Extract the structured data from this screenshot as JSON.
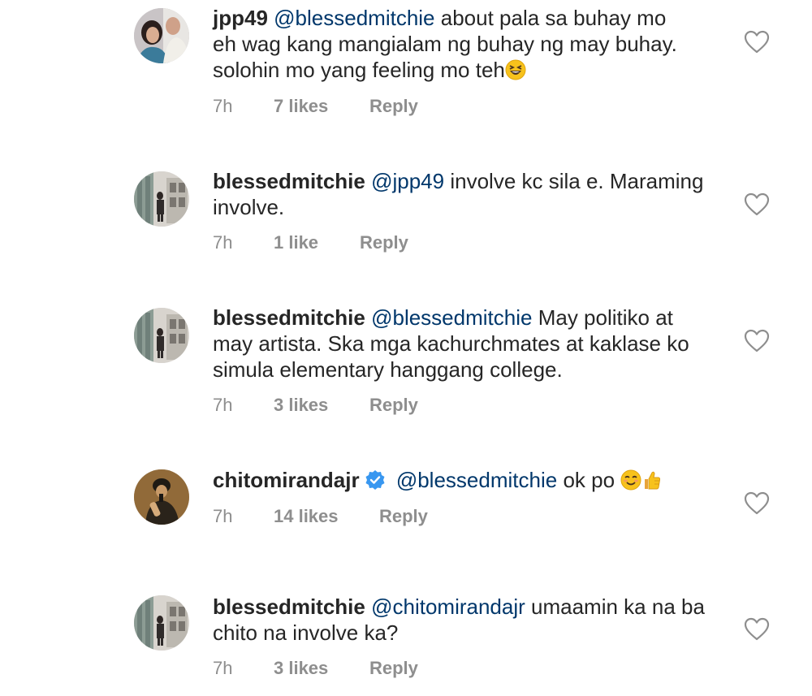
{
  "comments": [
    {
      "username": "jpp49",
      "lines": [
        "about pala sa buhay mo",
        "eh wag kang mangialam ng buhay ng may buhay.",
        "solohin mo yang feeling mo teh"
      ],
      "mention": "@blessedmitchie",
      "emoji": "grinning-squinting-face",
      "time": "7h",
      "likes": "7 likes",
      "reply": "Reply"
    },
    {
      "username": "blessedmitchie",
      "mention": "@jpp49",
      "line1": "involve kc sila e. Maraming",
      "line2": "involve.",
      "time": "7h",
      "likes": "1 like",
      "reply": "Reply"
    },
    {
      "username": "blessedmitchie",
      "mention": "@blessedmitchie",
      "line1": "May politiko at",
      "line2": "may artista. Ska mga kachurchmates at kaklase ko",
      "line3": "simula elementary hanggang college.",
      "time": "7h",
      "likes": "3 likes",
      "reply": "Reply"
    },
    {
      "username": "chitomirandajr",
      "verified": true,
      "mention": "@blessedmitchie",
      "text": "ok po",
      "emojis": [
        "smiling-face",
        "thumbs-up"
      ],
      "time": "7h",
      "likes": "14 likes",
      "reply": "Reply"
    },
    {
      "username": "blessedmitchie",
      "mention": "@chitomirandajr",
      "line1": "umaamin ka na ba",
      "line2": "chito na involve ka?",
      "time": "7h",
      "likes": "3 likes",
      "reply": "Reply"
    }
  ],
  "colors": {
    "text": "#262626",
    "mention": "#00376b",
    "meta": "#8e8e8e",
    "verified": "#3897f0"
  }
}
